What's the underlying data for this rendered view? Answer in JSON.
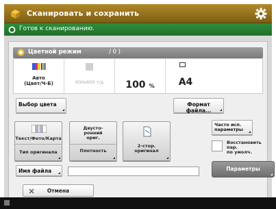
{
  "header": {
    "title": "Сканировать и сохранить"
  },
  "status": {
    "message": "Готов к сканированию."
  },
  "mode": {
    "label": "Цветной режим",
    "count": "/ 0 )"
  },
  "settings": {
    "color_label": "Авто\n(Цвет/Ч-Б)",
    "resolution_label": "600x600 т/д",
    "zoom_value": "100",
    "zoom_unit": "%",
    "paper_size": "A4"
  },
  "buttons": {
    "select_color": "Выбор цвета",
    "file_format": "Формат файла...",
    "original_type_top": "Текст/Фото/Карта",
    "original_type_bottom": "Тип оригинала",
    "duplex_top": "Двусто-\nронний\nориг.",
    "density": "Плотность",
    "duplex_original": "2-стор.\nоригинал",
    "frequently_used": "Часто исп.\nпараметры",
    "restore_defaults": "Восстановить пар.\nпо умолч.",
    "file_name": "Имя файла",
    "params": "Параметры",
    "cancel": "Отмена"
  },
  "file_name_value": ""
}
